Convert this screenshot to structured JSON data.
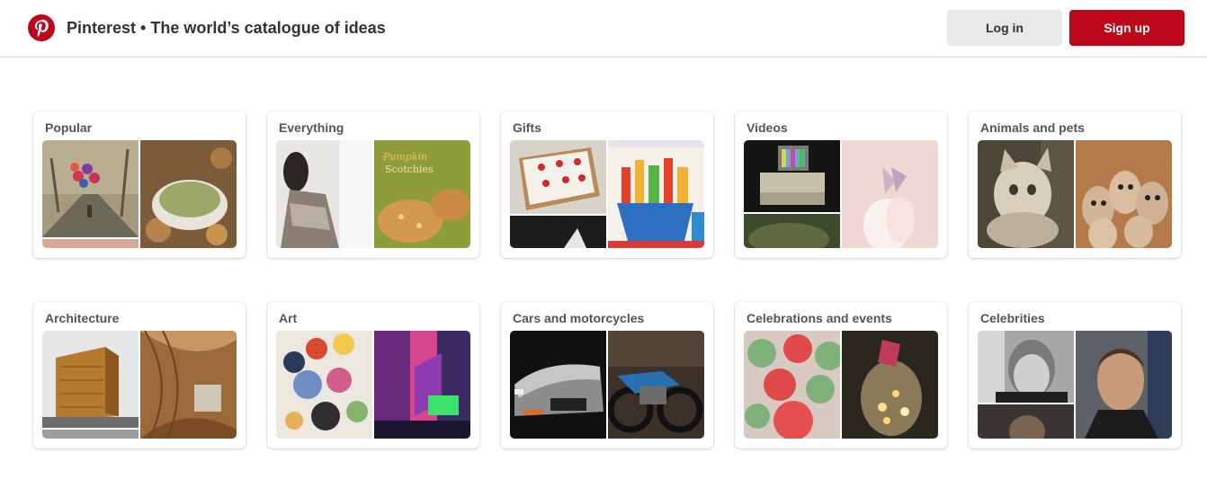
{
  "header": {
    "title": "Pinterest • The world’s catalogue of ideas",
    "login_label": "Log in",
    "signup_label": "Sign up",
    "logo_icon": "pinterest-logo-icon"
  },
  "colors": {
    "brand_red": "#bd081c",
    "login_bg": "#e9e9e9",
    "text_dark": "#333333",
    "card_title": "#555555"
  },
  "categories": [
    {
      "label": "Popular"
    },
    {
      "label": "Everything"
    },
    {
      "label": "Gifts"
    },
    {
      "label": "Videos"
    },
    {
      "label": "Animals and pets"
    },
    {
      "label": "Architecture"
    },
    {
      "label": "Art"
    },
    {
      "label": "Cars and motorcycles"
    },
    {
      "label": "Celebrations and events"
    },
    {
      "label": "Celebrities"
    }
  ]
}
